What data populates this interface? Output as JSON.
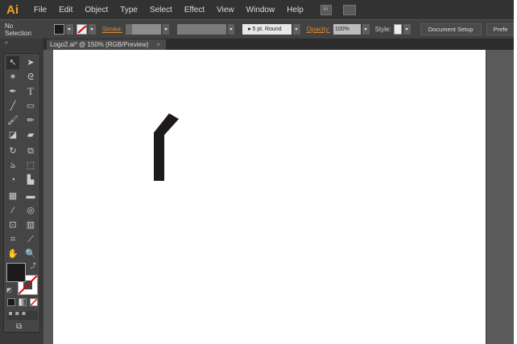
{
  "app": {
    "logo": "Ai"
  },
  "menu": [
    "File",
    "Edit",
    "Object",
    "Type",
    "Select",
    "Effect",
    "View",
    "Window",
    "Help"
  ],
  "menu_icons": {
    "bridge": "Br",
    "workspace": "arrange-documents-icon"
  },
  "control": {
    "selection": "No Selection",
    "stroke_label": "Stroke:",
    "brush": "5 pt. Round",
    "opacity_label": "Opacity:",
    "opacity": "100%",
    "style_label": "Style:",
    "doc_setup": "Document Setup",
    "prefs": "Prefe"
  },
  "tab": {
    "title": "Logo2.ai* @ 150% (RGB/Preview)",
    "close": "×"
  },
  "colors": {
    "fill": "#1e1a1b",
    "shape": "#1e1a1b",
    "accent": "#f7a21b"
  }
}
